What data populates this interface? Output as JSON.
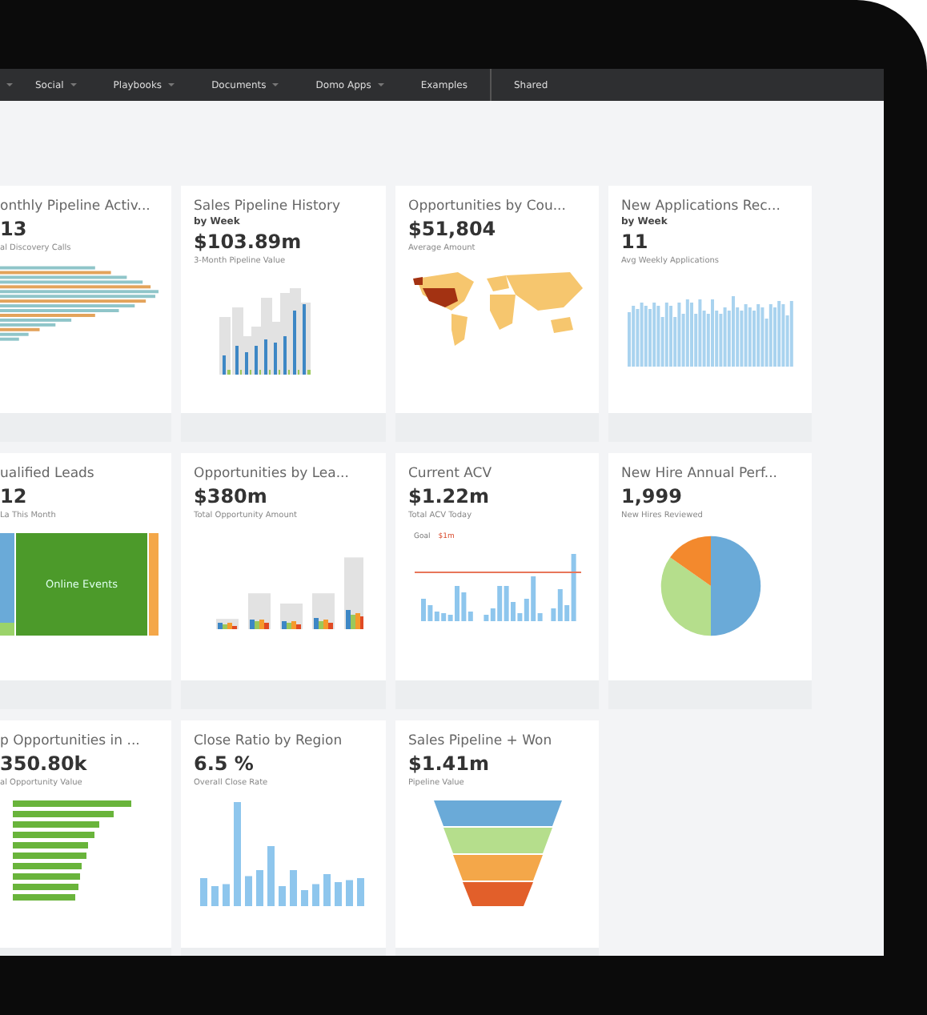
{
  "nav": {
    "items": [
      {
        "label": "Social",
        "caret": true,
        "divider": false
      },
      {
        "label": "Playbooks",
        "caret": true,
        "divider": false
      },
      {
        "label": "Documents",
        "caret": true,
        "divider": false
      },
      {
        "label": "Domo Apps",
        "caret": true,
        "divider": false
      },
      {
        "label": "Examples",
        "caret": false,
        "divider": false
      },
      {
        "label": "Shared",
        "caret": false,
        "divider": true
      }
    ]
  },
  "cards": [
    {
      "title": "onthly Pipeline Activ...",
      "value": "13",
      "caption": "al Discovery Calls",
      "kind": "hbars",
      "cut": true
    },
    {
      "title": "Sales Pipeline History",
      "subtitle": "by Week",
      "value": "$103.89m",
      "caption": "3-Month Pipeline Value",
      "kind": "bars",
      "cut": false
    },
    {
      "title": "Opportunities by Cou...",
      "value": "$51,804",
      "caption": "Average Amount",
      "kind": "map",
      "cut": false
    },
    {
      "title": "New Applications Rec...",
      "subtitle": "by Week",
      "value": "11",
      "caption": "Avg Weekly Applications",
      "kind": "histogram",
      "cut": false
    },
    {
      "title": "ualified Leads",
      "value": "12",
      "caption": "La This Month",
      "kind": "treemap",
      "chart_label": "Online Events",
      "cut": true
    },
    {
      "title": "Opportunities by Lea...",
      "value": "$380m",
      "caption": "Total Opportunity Amount",
      "kind": "grouped",
      "cut": false
    },
    {
      "title": "Current ACV",
      "value": "$1.22m",
      "caption": "Total ACV Today",
      "kind": "goal",
      "legend": [
        "Goal",
        "$1m"
      ],
      "cut": false
    },
    {
      "title": "New Hire Annual Perf...",
      "value": "1,999",
      "caption": "New Hires Reviewed",
      "kind": "pie",
      "cut": false
    },
    {
      "title": "p Opportunities in ...",
      "value": "350.80k",
      "caption": "al Opportunity Value",
      "kind": "greenbars",
      "cut": true
    },
    {
      "title": "Close Ratio by Region",
      "value": "6.5 %",
      "caption": "Overall Close Rate",
      "kind": "columns",
      "cut": false
    },
    {
      "title": "Sales Pipeline + Won",
      "value": "$1.41m",
      "caption": "Pipeline Value",
      "kind": "funnel",
      "cut": false
    }
  ]
}
